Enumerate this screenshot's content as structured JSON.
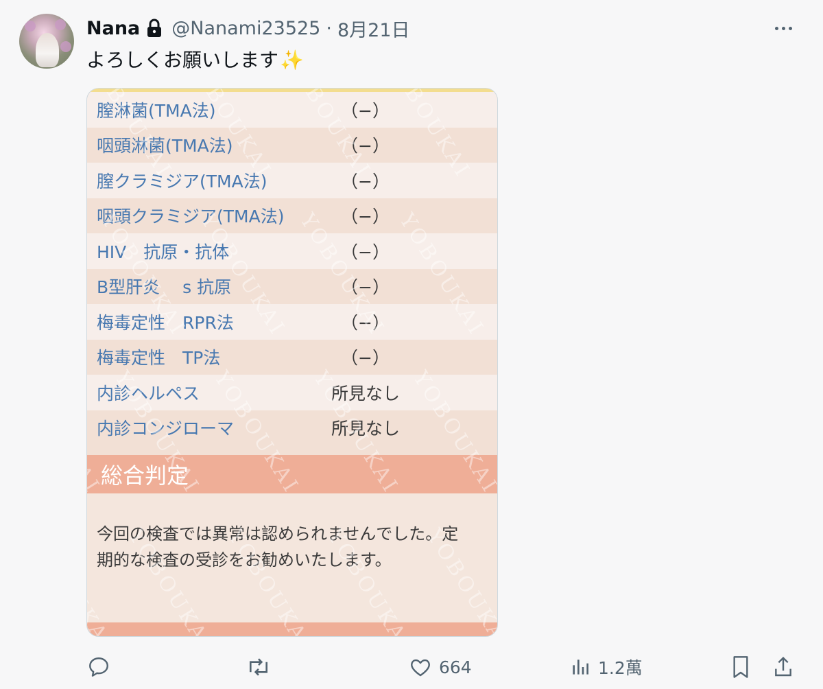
{
  "tweet": {
    "display_name": "Nana",
    "handle": "@Nanami23525",
    "date": "8月21日",
    "text": "よろしくお願いします",
    "text_emoji": "✨"
  },
  "media": {
    "watermark_text": "YOBOUKAI",
    "rows": [
      {
        "label": "膣淋菌(TMA法)",
        "value": "（−）"
      },
      {
        "label": "咽頭淋菌(TMA法)",
        "value": "（−）"
      },
      {
        "label": "膣クラミジア(TMA法)",
        "value": "（−）"
      },
      {
        "label": "咽頭クラミジア(TMA法)",
        "value": "（−）"
      },
      {
        "label": "HIV　抗原・抗体",
        "value": "（−）"
      },
      {
        "label": "B型肝炎　 s 抗原",
        "value": "（−）"
      },
      {
        "label": "梅毒定性　RPR法",
        "value": "（−）"
      },
      {
        "label": "梅毒定性　TP法",
        "value": "（−）"
      },
      {
        "label": "内診ヘルペス",
        "value": "所見なし"
      },
      {
        "label": "内診コンジローマ",
        "value": "所見なし"
      }
    ],
    "judgement_title": "総合判定",
    "summary_text": "今回の検査では異常は認められませんでした。定期的な検査の受診をお勧めいたします。"
  },
  "actions": {
    "reply_count": "",
    "repost_count": "",
    "like_count": "664",
    "views_count": "1.2萬"
  },
  "colors": {
    "accent_text": "#536471",
    "label_blue": "#4778b0",
    "judgement_band": "#efae97"
  }
}
